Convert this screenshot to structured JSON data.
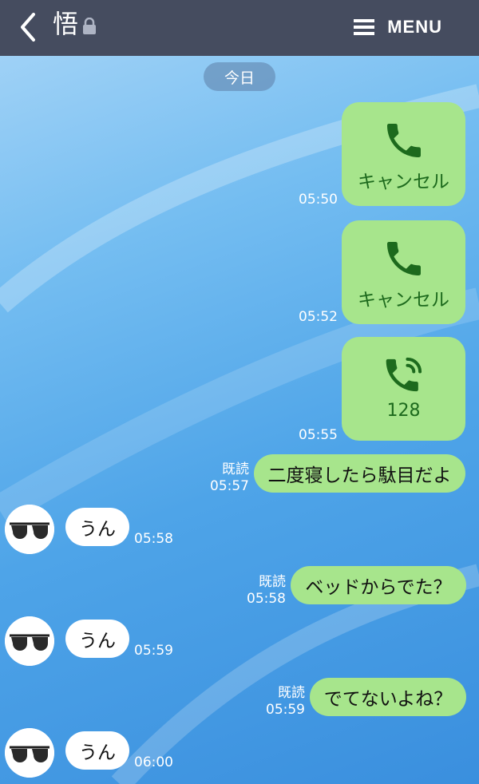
{
  "header": {
    "title": "悟",
    "menu_label": "MENU"
  },
  "date_pill": "今日",
  "calls": [
    {
      "label": "キャンセル",
      "time": "05:50",
      "icon": "phone-icon"
    },
    {
      "label": "キャンセル",
      "time": "05:52",
      "icon": "phone-icon"
    },
    {
      "label": "128",
      "time": "05:55",
      "icon": "phone-ringing-icon"
    }
  ],
  "messages": [
    {
      "side": "out",
      "text": "二度寝したら駄目だよ",
      "read": "既読",
      "time": "05:57"
    },
    {
      "side": "in",
      "text": "うん",
      "time": "05:58"
    },
    {
      "side": "out",
      "text": "ベッドからでた？",
      "read": "既読",
      "time": "05:58"
    },
    {
      "side": "in",
      "text": "うん",
      "time": "05:59"
    },
    {
      "side": "out",
      "text": "でてないよね？",
      "read": "既読",
      "time": "05:59"
    },
    {
      "side": "in",
      "text": "うん",
      "time": "06:00"
    }
  ],
  "colors": {
    "header": "#454c5f",
    "bubble_out": "#a7e58c",
    "call_icon": "#1d6a1d"
  }
}
